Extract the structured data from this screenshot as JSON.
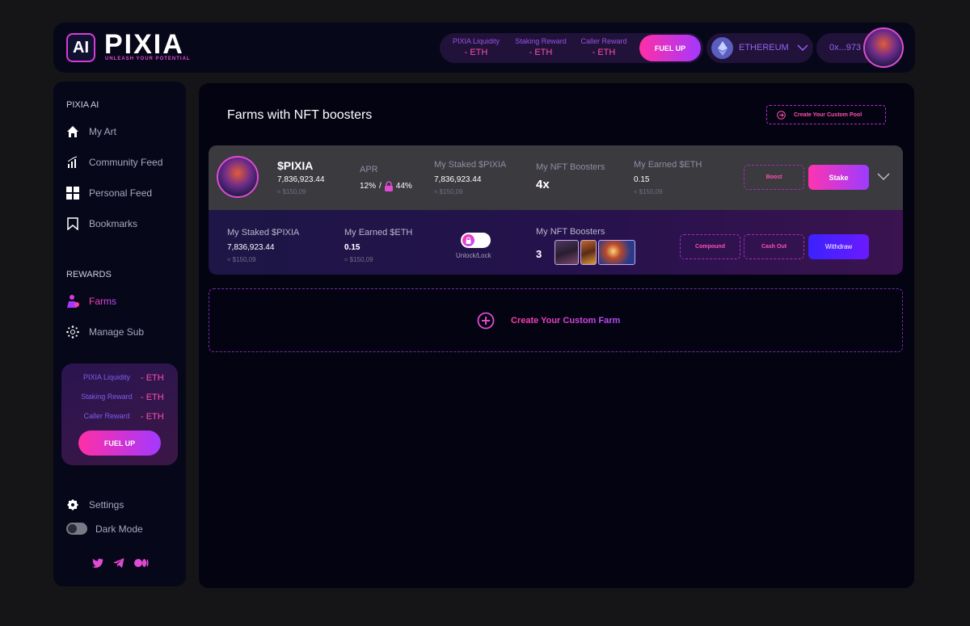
{
  "header": {
    "logo_box": "AI",
    "logo_title": "PIXIA",
    "logo_tagline": "UNLEASH YOUR POTENTIAL",
    "stats": [
      {
        "label": "PIXIA Liquidity",
        "value": "- ETH"
      },
      {
        "label": "Staking Reward",
        "value": "- ETH"
      },
      {
        "label": "Caller Reward",
        "value": "- ETH"
      }
    ],
    "fuel_up": "FUEL UP",
    "network": "ETHEREUM",
    "account": "0x...973"
  },
  "sidebar": {
    "section_ai": "PIXIA AI",
    "nav": [
      {
        "label": "My Art",
        "icon": "home-icon"
      },
      {
        "label": "Community Feed",
        "icon": "bar-chart-icon"
      },
      {
        "label": "Personal Feed",
        "icon": "grid-icon"
      },
      {
        "label": "Bookmarks",
        "icon": "bookmark-icon"
      }
    ],
    "section_rewards": "REWARDS",
    "rewards_nav": [
      {
        "label": "Farms",
        "icon": "farm-icon"
      },
      {
        "label": "Manage Sub",
        "icon": "network-icon"
      }
    ],
    "stats": [
      {
        "label": "PIXIA Liquidity",
        "value": "- ETH"
      },
      {
        "label": "Staking Reward",
        "value": "- ETH"
      },
      {
        "label": "Caller Reward",
        "value": "- ETH"
      }
    ],
    "fuel_up": "FUEL UP",
    "settings": "Settings",
    "dark_mode": "Dark Mode",
    "socials": [
      "twitter-icon",
      "telegram-icon",
      "medium-icon"
    ]
  },
  "main": {
    "title": "Farms with NFT boosters",
    "create_pool": "Create Your Custom Pool",
    "farm": {
      "token": "$PIXIA",
      "amount": "7,836,923.44",
      "amount_usd": "≈ $150,09",
      "apr_label": "APR",
      "apr_value": "12%",
      "apr_sep": "/",
      "apr_locked": "44%",
      "staked_label": "My Staked $PIXIA",
      "staked_value": "7,836,923.44",
      "staked_usd": "≈ $150,09",
      "boosters_label": "My NFT Boosters",
      "boosters_value": "4x",
      "earned_label": "My Earned $ETH",
      "earned_value": "0.15",
      "earned_usd": "≈ $150,09",
      "boost": "Boost",
      "stake": "Stake"
    },
    "detail": {
      "staked_label": "My Staked $PIXIA",
      "staked_value": "7,836,923.44",
      "staked_usd": "≈ $150,09",
      "earned_label": "My Earned $ETH",
      "earned_value": "0.15",
      "earned_usd": "≈ $150,09",
      "lock_label": "Unlock/Lock",
      "boosters_label": "My NFT Boosters",
      "boosters_count": "3",
      "compound": "Compound",
      "cash_out": "Cash Out",
      "withdraw": "Withdraw"
    },
    "create_farm": "Create Your Custom Farm"
  },
  "colors": {
    "accent_pink": "#ff3ea5",
    "accent_purple": "#b74bff",
    "withdraw_blue": "#3b22ff",
    "panel": "#07071a"
  }
}
